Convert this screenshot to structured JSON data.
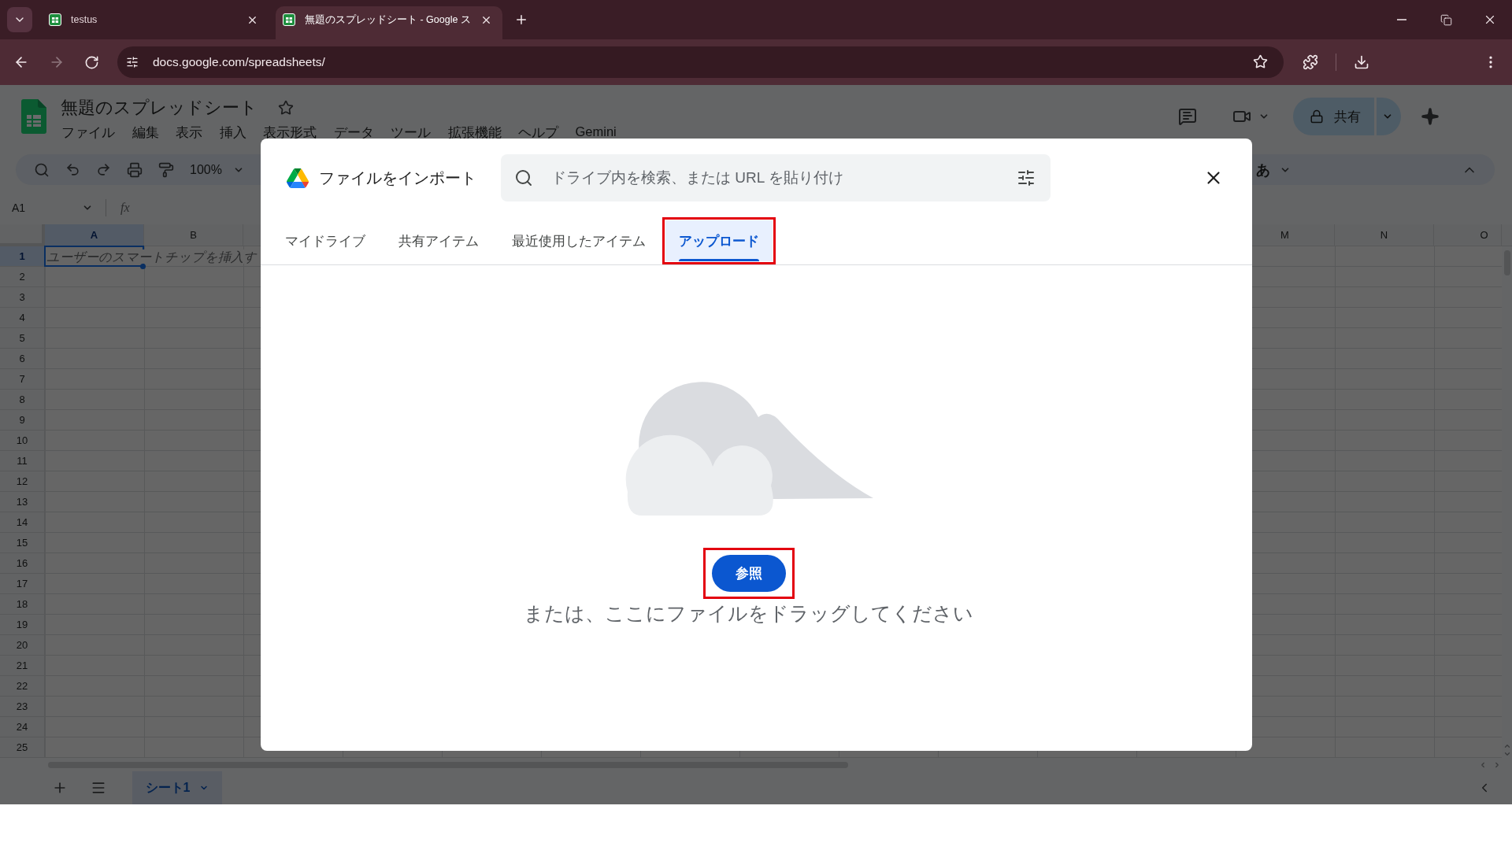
{
  "browser": {
    "tabs": [
      {
        "title": "testus",
        "selected": false
      },
      {
        "title": "無題のスプレッドシート - Google ス",
        "selected": true
      }
    ],
    "address": "docs.google.com/spreadsheets/"
  },
  "sheets": {
    "title": "無題のスプレッドシート",
    "menu": [
      "ファイル",
      "編集",
      "表示",
      "挿入",
      "表示形式",
      "データ",
      "ツール",
      "拡張機能",
      "ヘルプ",
      "Gemini"
    ],
    "share_button": "共有",
    "zoom": "100%",
    "input_tools": "あ",
    "name_box": "A1",
    "formula_label": "fx",
    "columns": {
      "left": [
        {
          "label": "A",
          "selected": true
        },
        {
          "label": "B",
          "selected": false
        }
      ],
      "right": [
        {
          "label": "M",
          "selected": false
        },
        {
          "label": "N",
          "selected": false
        },
        {
          "label": "O",
          "selected": false
        }
      ]
    },
    "rows": [
      {
        "label": "1",
        "selected": true
      },
      {
        "label": "2",
        "selected": false
      },
      {
        "label": "3",
        "selected": false
      },
      {
        "label": "4",
        "selected": false
      },
      {
        "label": "5",
        "selected": false
      },
      {
        "label": "6",
        "selected": false
      },
      {
        "label": "7",
        "selected": false
      },
      {
        "label": "8",
        "selected": false
      },
      {
        "label": "9",
        "selected": false
      },
      {
        "label": "10",
        "selected": false
      },
      {
        "label": "11",
        "selected": false
      },
      {
        "label": "12",
        "selected": false
      },
      {
        "label": "13",
        "selected": false
      },
      {
        "label": "14",
        "selected": false
      },
      {
        "label": "15",
        "selected": false
      },
      {
        "label": "16",
        "selected": false
      },
      {
        "label": "17",
        "selected": false
      },
      {
        "label": "18",
        "selected": false
      },
      {
        "label": "19",
        "selected": false
      },
      {
        "label": "20",
        "selected": false
      },
      {
        "label": "21",
        "selected": false
      },
      {
        "label": "22",
        "selected": false
      },
      {
        "label": "23",
        "selected": false
      },
      {
        "label": "24",
        "selected": false
      },
      {
        "label": "25",
        "selected": false
      }
    ],
    "active_cell": {
      "hint": "ユーザーのスマートチップを挿入す"
    },
    "sheet_tabs": [
      {
        "label": "シート1",
        "selected": true
      }
    ]
  },
  "dialog": {
    "title": "ファイルをインポート",
    "search": {
      "placeholder": "ドライブ内を検索、または URL を貼り付け"
    },
    "tabs": [
      {
        "label": "マイドライブ",
        "selected": false,
        "highlighted": false
      },
      {
        "label": "共有アイテム",
        "selected": false,
        "highlighted": false
      },
      {
        "label": "最近使用したアイテム",
        "selected": false,
        "highlighted": false
      },
      {
        "label": "アップロード",
        "selected": true,
        "highlighted": true
      }
    ],
    "browse_button": {
      "label": "参照",
      "highlighted": true
    },
    "drop_hint": "または、ここにファイルをドラッグしてください"
  }
}
